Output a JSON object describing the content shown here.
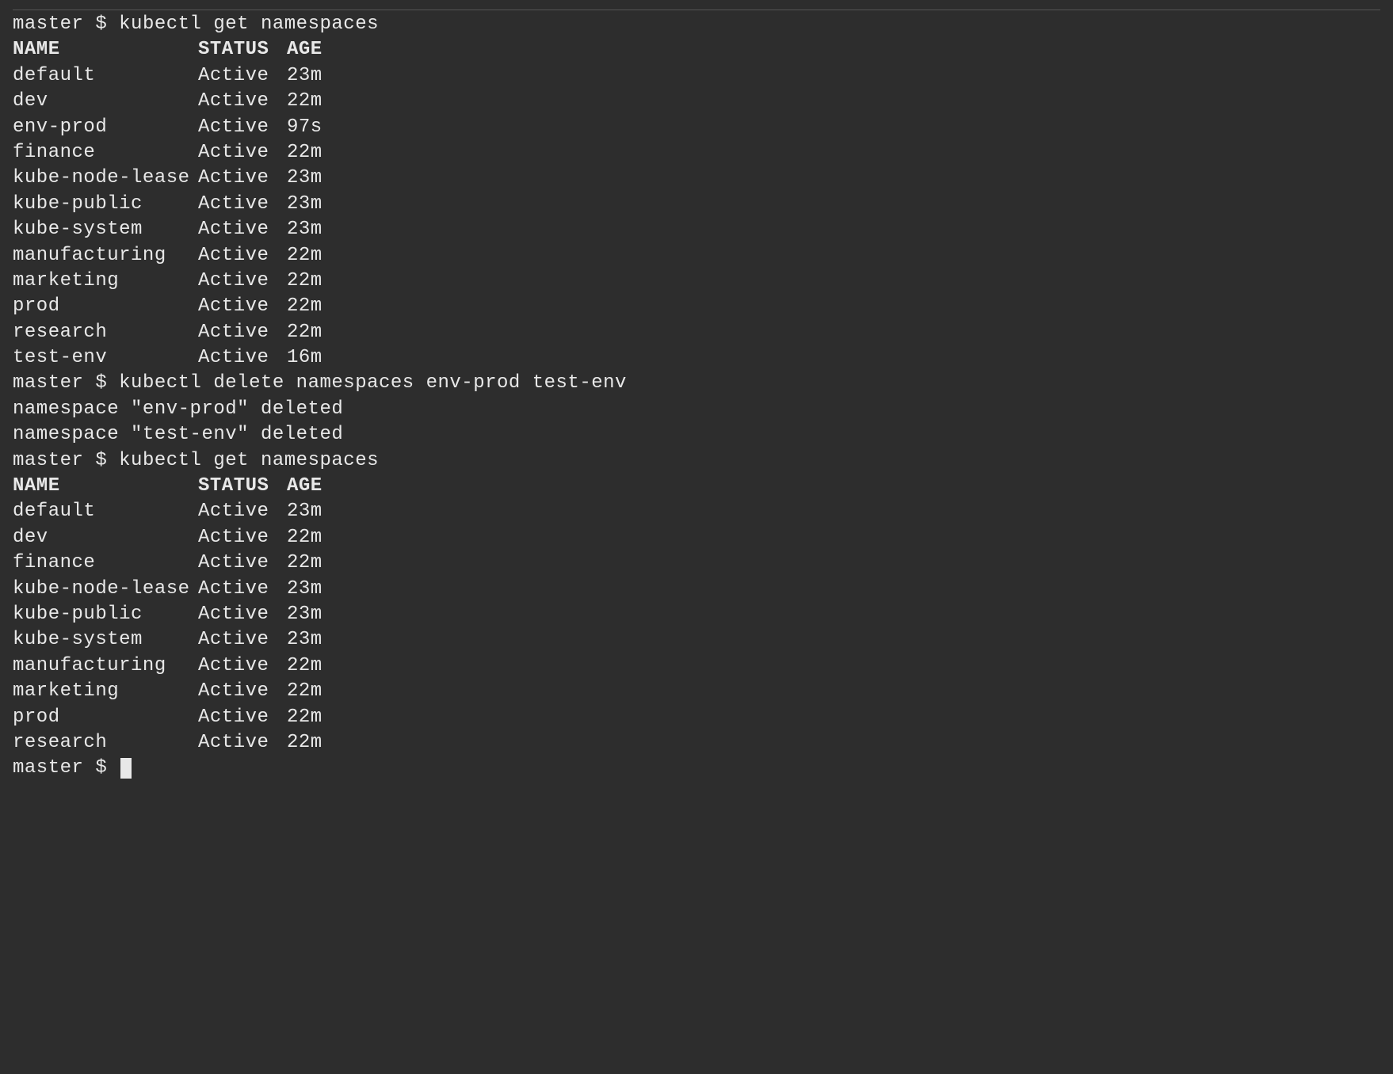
{
  "prompts": {
    "host": "master",
    "symbol": "$"
  },
  "commands": {
    "cmd1": "kubectl get namespaces",
    "cmd2": "kubectl delete namespaces env-prod test-env",
    "cmd3": "kubectl get namespaces"
  },
  "headers": {
    "name": "NAME",
    "status": "STATUS",
    "age": "AGE"
  },
  "table1": {
    "rows": [
      {
        "name": "default",
        "status": "Active",
        "age": "23m"
      },
      {
        "name": "dev",
        "status": "Active",
        "age": "22m"
      },
      {
        "name": "env-prod",
        "status": "Active",
        "age": "97s"
      },
      {
        "name": "finance",
        "status": "Active",
        "age": "22m"
      },
      {
        "name": "kube-node-lease",
        "status": "Active",
        "age": "23m"
      },
      {
        "name": "kube-public",
        "status": "Active",
        "age": "23m"
      },
      {
        "name": "kube-system",
        "status": "Active",
        "age": "23m"
      },
      {
        "name": "manufacturing",
        "status": "Active",
        "age": "22m"
      },
      {
        "name": "marketing",
        "status": "Active",
        "age": "22m"
      },
      {
        "name": "prod",
        "status": "Active",
        "age": "22m"
      },
      {
        "name": "research",
        "status": "Active",
        "age": "22m"
      },
      {
        "name": "test-env",
        "status": "Active",
        "age": "16m"
      }
    ]
  },
  "delete_output": {
    "line1": "namespace \"env-prod\" deleted",
    "line2": "namespace \"test-env\" deleted"
  },
  "table2": {
    "rows": [
      {
        "name": "default",
        "status": "Active",
        "age": "23m"
      },
      {
        "name": "dev",
        "status": "Active",
        "age": "22m"
      },
      {
        "name": "finance",
        "status": "Active",
        "age": "22m"
      },
      {
        "name": "kube-node-lease",
        "status": "Active",
        "age": "23m"
      },
      {
        "name": "kube-public",
        "status": "Active",
        "age": "23m"
      },
      {
        "name": "kube-system",
        "status": "Active",
        "age": "23m"
      },
      {
        "name": "manufacturing",
        "status": "Active",
        "age": "22m"
      },
      {
        "name": "marketing",
        "status": "Active",
        "age": "22m"
      },
      {
        "name": "prod",
        "status": "Active",
        "age": "22m"
      },
      {
        "name": "research",
        "status": "Active",
        "age": "22m"
      }
    ]
  }
}
